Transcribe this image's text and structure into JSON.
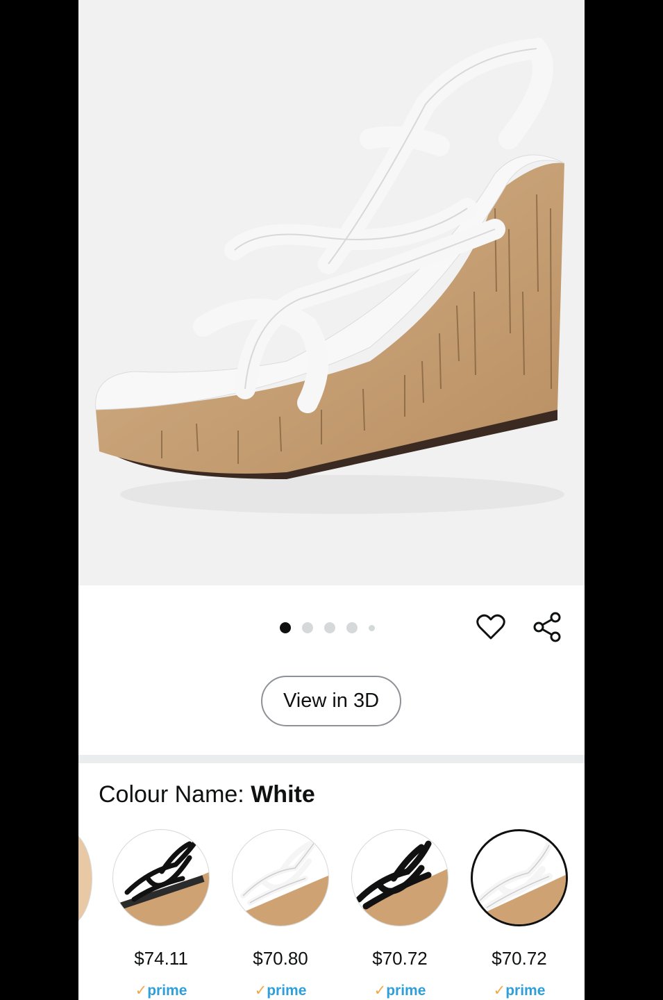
{
  "gallery": {
    "image_alt": "White strappy cork wedge sandal",
    "total_images": 5,
    "active_index": 1
  },
  "actions": {
    "wishlist_icon": "heart-icon",
    "share_icon": "share-icon"
  },
  "view_3d": {
    "label": "View in 3D"
  },
  "colour": {
    "label": "Colour Name: ",
    "value": "White"
  },
  "swatches": [
    {
      "price": "$74.11",
      "prime": "prime",
      "strap_color": "#111111",
      "selected": false
    },
    {
      "price": "$70.80",
      "prime": "prime",
      "strap_color": "#ffffff",
      "selected": false
    },
    {
      "price": "$70.72",
      "prime": "prime",
      "strap_color": "#111111",
      "selected": false
    },
    {
      "price": "$70.72",
      "prime": "prime",
      "strap_color": "#ffffff",
      "selected": true
    }
  ],
  "colors": {
    "text": "#0f1111",
    "prime_blue": "#2f9fd8",
    "prime_check": "#f3a847",
    "cork": "#c9a479"
  }
}
